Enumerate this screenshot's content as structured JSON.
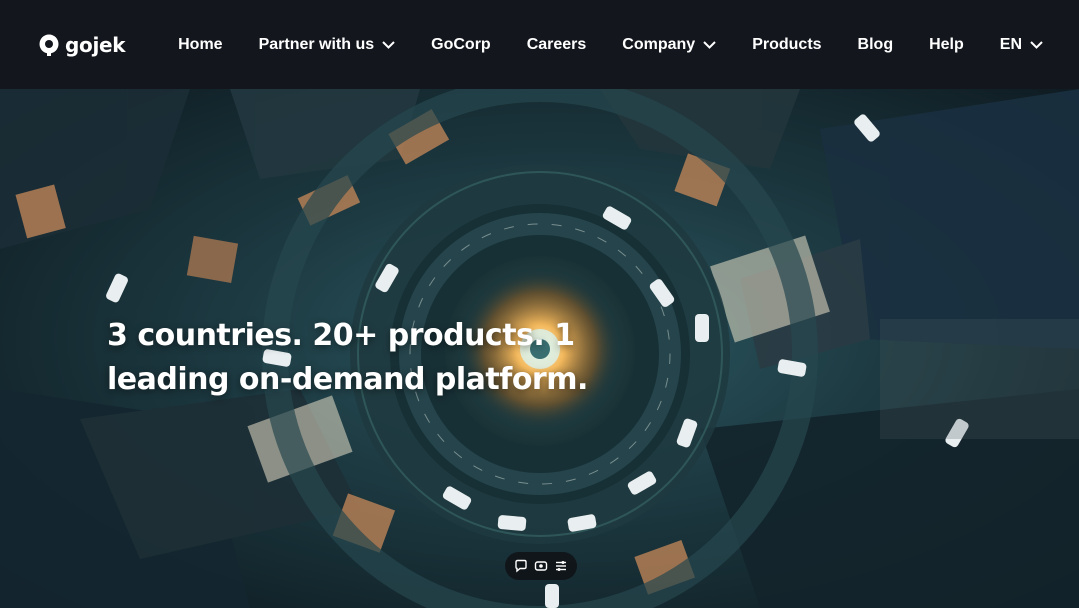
{
  "brand": {
    "name": "gojek",
    "logo_icon": "gojek-logo-icon"
  },
  "nav": {
    "items": [
      {
        "label": "Home",
        "has_dropdown": false
      },
      {
        "label": "Partner with us",
        "has_dropdown": true
      },
      {
        "label": "GoCorp",
        "has_dropdown": false
      },
      {
        "label": "Careers",
        "has_dropdown": false
      },
      {
        "label": "Company",
        "has_dropdown": true
      },
      {
        "label": "Products",
        "has_dropdown": false
      },
      {
        "label": "Blog",
        "has_dropdown": false
      },
      {
        "label": "Help",
        "has_dropdown": false
      }
    ],
    "language": {
      "label": "EN",
      "has_dropdown": true
    }
  },
  "hero": {
    "headline_line1": "3 countries. 20+ products. 1",
    "headline_line2": "leading on-demand platform.",
    "background": "aerial-night-roundabout-city-image",
    "controls": [
      {
        "icon": "chat-bubble-icon"
      },
      {
        "icon": "captions-icon"
      },
      {
        "icon": "settings-sliders-icon"
      }
    ]
  },
  "colors": {
    "navbar_bg": "#13171d",
    "text": "#ffffff",
    "ring_glow": "#f2b55a"
  }
}
